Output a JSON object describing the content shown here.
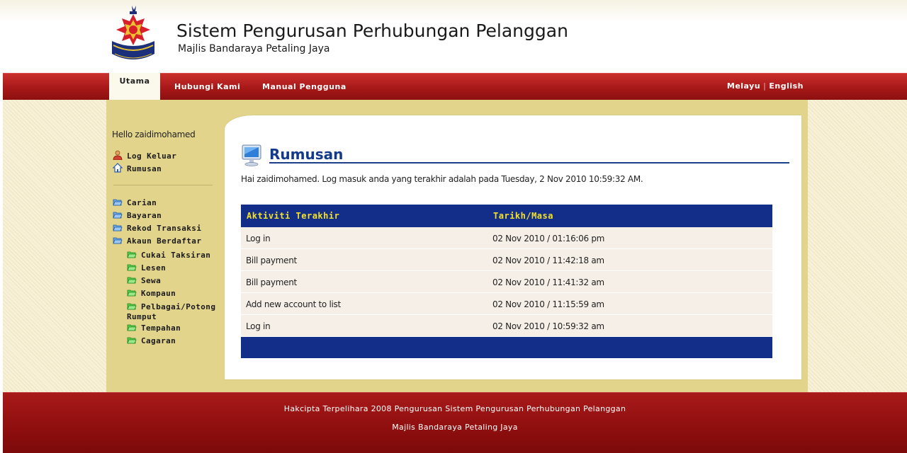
{
  "header": {
    "title": "Sistem Pengurusan Perhubungan Pelanggan",
    "subtitle": "Majlis Bandaraya Petaling Jaya"
  },
  "nav": {
    "items": [
      {
        "label": "Utama",
        "active": true
      },
      {
        "label": "Hubungi Kami",
        "active": false
      },
      {
        "label": "Manual Pengguna",
        "active": false
      }
    ],
    "lang": {
      "melayu": "Melayu",
      "separator": "|",
      "english": "English"
    }
  },
  "sidebar": {
    "hello": "Hello zaidimohamed",
    "top_links": [
      {
        "label": "Log Keluar",
        "icon": "user-icon"
      },
      {
        "label": "Rumusan",
        "icon": "home-icon"
      }
    ],
    "menu": [
      {
        "label": "Carian",
        "icon": "folder-open-icon"
      },
      {
        "label": "Bayaran",
        "icon": "folder-open-icon"
      },
      {
        "label": "Rekod Transaksi",
        "icon": "folder-open-icon"
      },
      {
        "label": "Akaun Berdaftar",
        "icon": "folder-open-icon"
      }
    ],
    "submenu": [
      {
        "label": "Cukai Taksiran",
        "icon": "folder-open-green-icon"
      },
      {
        "label": "Lesen",
        "icon": "folder-open-green-icon"
      },
      {
        "label": "Sewa",
        "icon": "folder-open-green-icon"
      },
      {
        "label": "Kompaun",
        "icon": "folder-open-green-icon"
      },
      {
        "label": "Pelbagai/Potong",
        "label2": "Rumput",
        "icon": "folder-open-green-icon"
      },
      {
        "label": "Tempahan",
        "icon": "folder-open-green-icon"
      },
      {
        "label": "Cagaran",
        "icon": "folder-open-green-icon"
      }
    ]
  },
  "main": {
    "title": "Rumusan",
    "greeting": "Hai zaidimohamed. Log masuk anda yang terakhir adalah pada Tuesday, 2 Nov 2010 10:59:32 AM.",
    "table": {
      "headers": [
        "Aktiviti Terakhir",
        "Tarikh/Masa"
      ],
      "rows": [
        [
          "Log in",
          "02 Nov 2010 / 01:16:06 pm"
        ],
        [
          "Bill payment",
          "02 Nov 2010 / 11:42:18 am"
        ],
        [
          "Bill payment",
          "02 Nov 2010 / 11:41:32 am"
        ],
        [
          "Add new account to list",
          "02 Nov 2010 / 11:15:59 am"
        ],
        [
          "Log in",
          "02 Nov 2010 / 10:59:32 am"
        ]
      ]
    }
  },
  "footer": {
    "line1": "Hakcipta Terpelihara 2008 Pengurusan Sistem Pengurusan Perhubungan Pelanggan",
    "line2": "Majlis Bandaraya Petaling Jaya"
  },
  "colors": {
    "nav_red": "#a81818",
    "sidebar_tan": "#e3d48c",
    "title_blue": "#133a8c",
    "table_header_bg": "#132e88",
    "table_header_text": "#f5e12a"
  }
}
